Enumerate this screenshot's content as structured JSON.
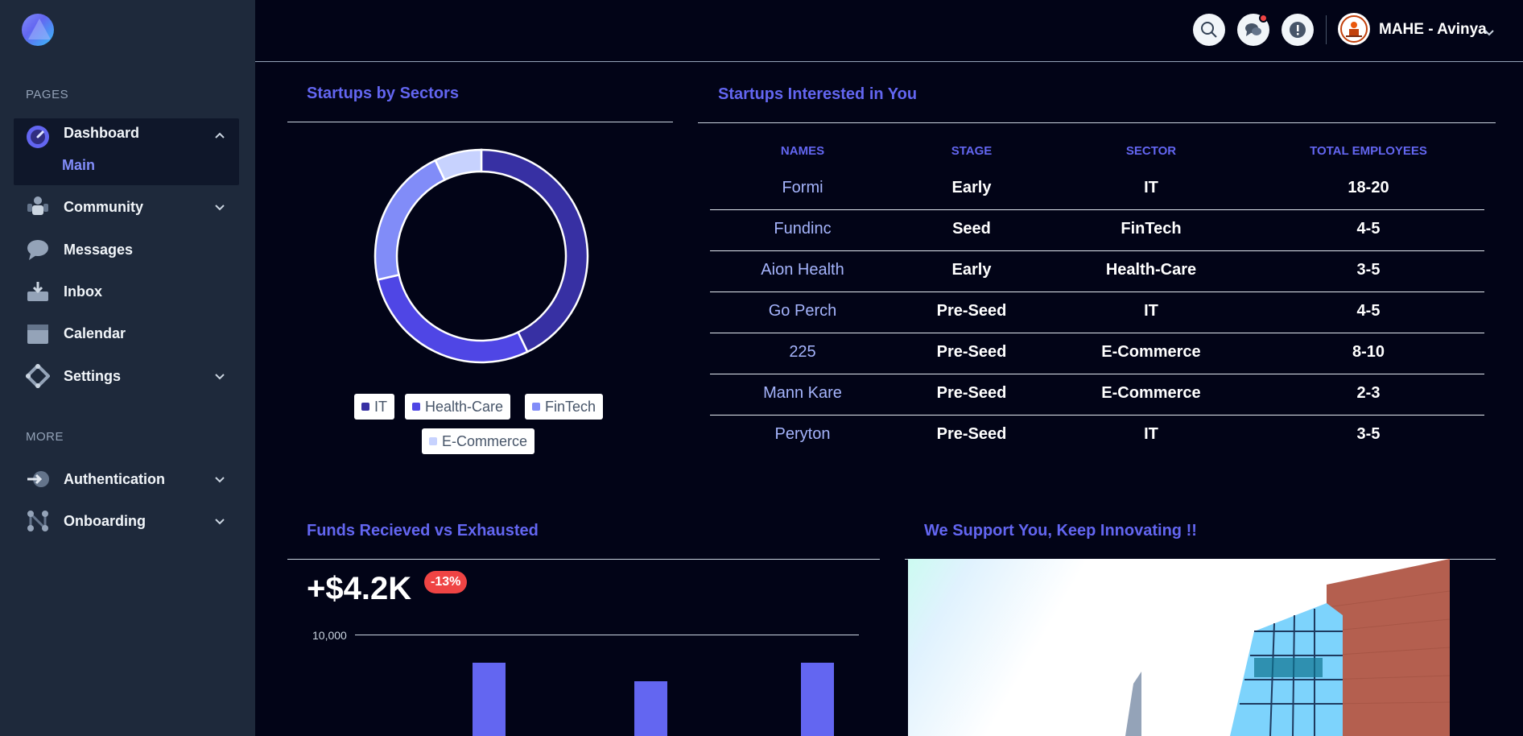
{
  "sidebar": {
    "sections": {
      "pages": "PAGES",
      "more": "MORE"
    },
    "items": [
      {
        "label": "Dashboard",
        "icon": "dashboard-gauge-icon",
        "expanded": true,
        "sub": "Main"
      },
      {
        "label": "Community",
        "icon": "community-icon",
        "expanded": false
      },
      {
        "label": "Messages",
        "icon": "messages-icon"
      },
      {
        "label": "Inbox",
        "icon": "inbox-icon"
      },
      {
        "label": "Calendar",
        "icon": "calendar-icon"
      },
      {
        "label": "Settings",
        "icon": "settings-icon",
        "expanded": false
      }
    ],
    "more_items": [
      {
        "label": "Authentication",
        "icon": "authentication-icon",
        "expanded": false
      },
      {
        "label": "Onboarding",
        "icon": "onboarding-icon",
        "expanded": false
      }
    ]
  },
  "header": {
    "user_name": "MAHE - Avinya",
    "icons": [
      "search-icon",
      "chat-icon",
      "info-icon"
    ],
    "has_notification": true
  },
  "sectors": {
    "title": "Startups by Sectors",
    "legend": [
      "IT",
      "Health-Care",
      "FinTech",
      "E-Commerce"
    ],
    "colors": [
      "#3730a3",
      "#4f46e5",
      "#818cf8",
      "#c7d2fe"
    ],
    "chart_data": {
      "type": "pie",
      "categories": [
        "IT",
        "Health-Care",
        "FinTech",
        "E-Commerce"
      ],
      "values": [
        3,
        2,
        1.5,
        0.5
      ]
    }
  },
  "interested": {
    "title": "Startups Interested in You",
    "columns": [
      "NAMES",
      "STAGE",
      "SECTOR",
      "TOTAL EMPLOYEES"
    ],
    "rows": [
      [
        "Formi",
        "Early",
        "IT",
        "18-20"
      ],
      [
        "Fundinc",
        "Seed",
        "FinTech",
        "4-5"
      ],
      [
        "Aion Health",
        "Early",
        "Health-Care",
        "3-5"
      ],
      [
        "Go Perch",
        "Pre-Seed",
        "IT",
        "4-5"
      ],
      [
        "225",
        "Pre-Seed",
        "E-Commerce",
        "8-10"
      ],
      [
        "Mann Kare",
        "Pre-Seed",
        "E-Commerce",
        "2-3"
      ],
      [
        "Peryton",
        "Pre-Seed",
        "IT",
        "3-5"
      ]
    ]
  },
  "funds": {
    "title": "Funds Recieved vs Exhausted",
    "value": "+$4.2K",
    "change": "-13%",
    "chart_data": {
      "type": "bar",
      "y_ticks": [
        "10,000"
      ],
      "ylim": [
        0,
        10000
      ],
      "values": [
        8800,
        8000,
        8800
      ]
    }
  },
  "support": {
    "title": "We Support You, Keep Innovating !!"
  }
}
